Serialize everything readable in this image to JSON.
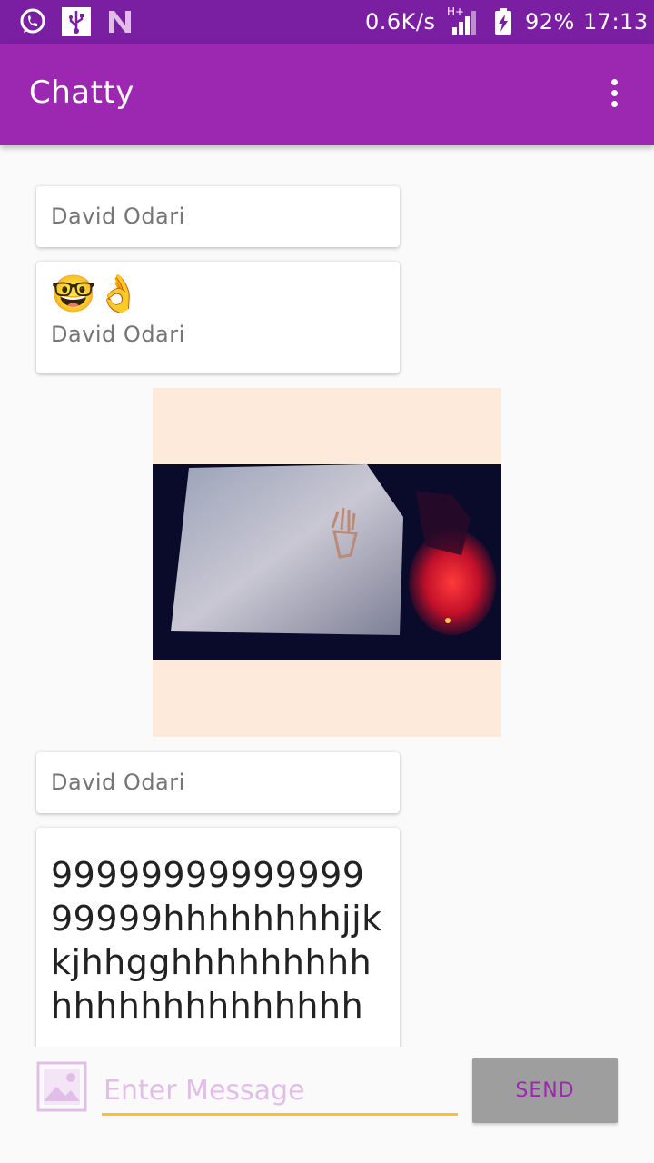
{
  "status_bar": {
    "speed": "0.6K/s",
    "network": "H+",
    "battery": "92%",
    "time": "17:13",
    "icons": [
      "whatsapp-icon",
      "usb-icon",
      "notification-n-icon",
      "signal-icon",
      "battery-charging-icon"
    ]
  },
  "app_bar": {
    "title": "Chatty",
    "menu_icon": "overflow-menu-icon"
  },
  "messages": [
    {
      "type": "name",
      "sender": "David Odari"
    },
    {
      "type": "text",
      "text": "🤓👌",
      "sender": "David Odari"
    },
    {
      "type": "image",
      "content": "photo"
    },
    {
      "type": "name",
      "sender": "David Odari"
    },
    {
      "type": "text",
      "text": "9999999999999999999hhhhhhhhjjkkjhhgghhhhhhhhhhhhhhhhhhhhhhh"
    }
  ],
  "input_bar": {
    "placeholder": "Enter Message",
    "value": "",
    "send_label": "SEND",
    "gallery_icon": "image-icon"
  },
  "colors": {
    "status_bar": "#7b1fa2",
    "primary": "#9c27b0",
    "accent": "#fbc02d",
    "image_bg": "#feeadb",
    "send_bg": "#9e9e9e"
  }
}
